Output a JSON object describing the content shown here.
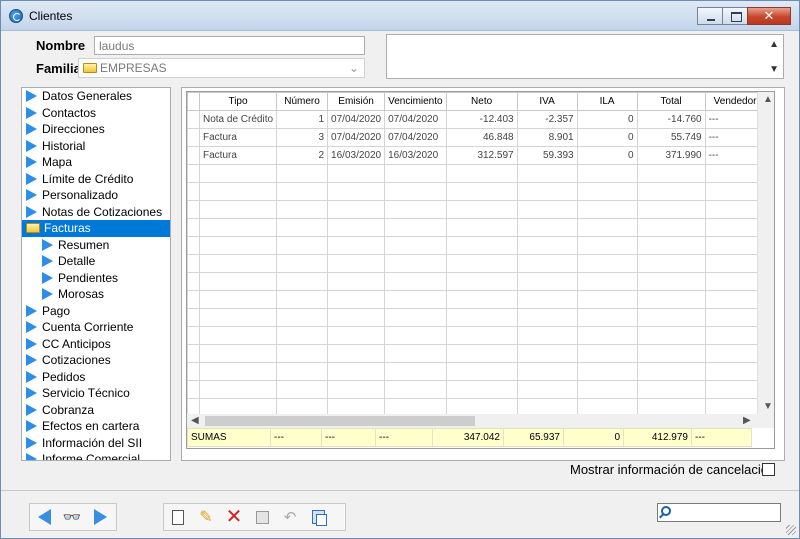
{
  "window": {
    "title": "Clientes"
  },
  "form": {
    "nombre_label": "Nombre",
    "nombre_value": "laudus",
    "familia_label": "Familia",
    "familia_value": "EMPRESAS"
  },
  "nav": {
    "items": [
      {
        "label": "Datos Generales",
        "icon": "triangle-right-icon",
        "level": 0
      },
      {
        "label": "Contactos",
        "icon": "triangle-right-icon",
        "level": 0
      },
      {
        "label": "Direcciones",
        "icon": "triangle-right-icon",
        "level": 0
      },
      {
        "label": "Historial",
        "icon": "triangle-right-icon",
        "level": 0
      },
      {
        "label": "Mapa",
        "icon": "triangle-right-icon",
        "level": 0
      },
      {
        "label": "Límite de Crédito",
        "icon": "triangle-right-icon",
        "level": 0
      },
      {
        "label": "Personalizado",
        "icon": "triangle-right-icon",
        "level": 0
      },
      {
        "label": "Notas de Cotizaciones",
        "icon": "triangle-right-icon",
        "level": 0
      },
      {
        "label": "Facturas",
        "icon": "folder-open-icon",
        "level": 0,
        "selected": true
      },
      {
        "label": "Resumen",
        "icon": "triangle-right-icon",
        "level": 1
      },
      {
        "label": "Detalle",
        "icon": "triangle-right-icon",
        "level": 1
      },
      {
        "label": "Pendientes",
        "icon": "triangle-right-icon",
        "level": 1
      },
      {
        "label": "Morosas",
        "icon": "triangle-right-icon",
        "level": 1
      },
      {
        "label": "Pago",
        "icon": "triangle-right-icon",
        "level": 0
      },
      {
        "label": "Cuenta Corriente",
        "icon": "triangle-right-icon",
        "level": 0
      },
      {
        "label": "CC Anticipos",
        "icon": "triangle-right-icon",
        "level": 0
      },
      {
        "label": "Cotizaciones",
        "icon": "triangle-right-icon",
        "level": 0
      },
      {
        "label": "Pedidos",
        "icon": "triangle-right-icon",
        "level": 0
      },
      {
        "label": "Servicio Técnico",
        "icon": "triangle-right-icon",
        "level": 0
      },
      {
        "label": "Cobranza",
        "icon": "triangle-right-icon",
        "level": 0
      },
      {
        "label": "Efectos en cartera",
        "icon": "triangle-right-icon",
        "level": 0
      },
      {
        "label": "Información del SII",
        "icon": "triangle-right-icon",
        "level": 0
      },
      {
        "label": "Informe Comercial",
        "icon": "triangle-right-icon",
        "level": 0
      }
    ]
  },
  "table": {
    "columns": [
      "Tipo",
      "Número",
      "Emisión",
      "Vencimiento",
      "Neto",
      "IVA",
      "ILA",
      "Total",
      "Vendedor"
    ],
    "rows": [
      [
        "Nota de Crédito",
        "1",
        "07/04/2020",
        "07/04/2020",
        "-12.403",
        "-2.357",
        "0",
        "-14.760",
        "---"
      ],
      [
        "Factura",
        "3",
        "07/04/2020",
        "07/04/2020",
        "46.848",
        "8.901",
        "0",
        "55.749",
        "---"
      ],
      [
        "Factura",
        "2",
        "16/03/2020",
        "16/03/2020",
        "312.597",
        "59.393",
        "0",
        "371.990",
        "---"
      ]
    ],
    "empty_rows": 14,
    "sums": [
      "SUMAS",
      "---",
      "---",
      "---",
      "347.042",
      "65.937",
      "0",
      "412.979",
      "---"
    ]
  },
  "cancel_option": {
    "label": "Mostrar información de cancelación",
    "checked": false
  },
  "colors": {
    "selection": "#0078d7",
    "sums_row": "#ffffcc",
    "nav_arrow": "#2b8ee8"
  }
}
